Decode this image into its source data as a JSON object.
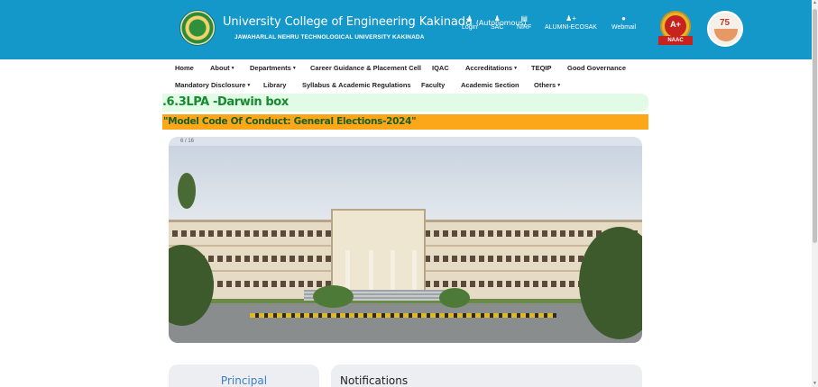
{
  "header": {
    "title": "University College of Engineering Kakinada",
    "title_suffix": "(Autonomous)",
    "subtitle": "JAWAHARLAL NEHRU TECHNOLOGICAL UNIVERSITY KAKINADA",
    "brand_color": "#1497c9",
    "links": [
      {
        "label": "Login",
        "icon": "user-icon"
      },
      {
        "label": "SAC",
        "icon": "group-icon"
      },
      {
        "label": "NIRF",
        "icon": "document-icon"
      },
      {
        "label": "ALUMNI-ECOSAK",
        "icon": "add-user-icon"
      },
      {
        "label": "Webmail",
        "icon": "globe-icon"
      }
    ],
    "naac_badge": {
      "grade": "A+",
      "label": "NAAC"
    },
    "anniversary_emblem": {
      "number": "75"
    }
  },
  "nav": {
    "row1": [
      {
        "label": "Home",
        "dropdown": false
      },
      {
        "label": "About",
        "dropdown": true
      },
      {
        "label": "Departments",
        "dropdown": true
      },
      {
        "label": "Career Guidance & Placement Cell",
        "dropdown": false
      },
      {
        "label": "IQAC",
        "dropdown": false
      },
      {
        "label": "Accreditations",
        "dropdown": true
      },
      {
        "label": "TEQIP",
        "dropdown": false
      },
      {
        "label": "Good Governance",
        "dropdown": false
      }
    ],
    "row2": [
      {
        "label": "Mandatory Disclosure",
        "dropdown": true
      },
      {
        "label": "Library",
        "dropdown": false
      },
      {
        "label": "Syllabus & Academic Regulations",
        "dropdown": false
      },
      {
        "label": "Faculty",
        "dropdown": false
      },
      {
        "label": "Academic Section",
        "dropdown": false
      },
      {
        "label": "Others",
        "dropdown": true
      }
    ]
  },
  "marquees": {
    "placements": ".6.3LPA -Darwin box",
    "notice": "\"Model Code Of Conduct: General Elections-2024\""
  },
  "slider": {
    "counter": "6 / 16"
  },
  "cards": {
    "principal": "Principal",
    "notifications": "Notifications"
  }
}
